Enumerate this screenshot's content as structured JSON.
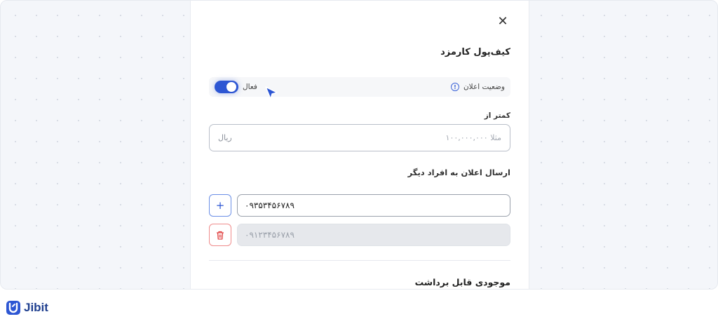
{
  "panel": {
    "title": "کیف‌پول کارمزد",
    "close_icon": "close-icon",
    "status": {
      "label": "وضعیت اعلان",
      "info_icon": "info-icon",
      "toggle_label": "فعال",
      "toggle_on": true
    },
    "threshold": {
      "label": "کمتر از",
      "placeholder": "مثلا ۱۰۰,۰۰۰,۰۰۰",
      "unit": "ریال"
    },
    "notify_others": {
      "label": "ارسال اعلان به افراد دیگر",
      "phones": [
        {
          "value": "۰۹۳۵۳۴۵۶۷۸۹",
          "state": "active",
          "action_icon": "plus-icon"
        },
        {
          "value": "۰۹۱۲۳۴۵۶۷۸۹",
          "state": "disabled",
          "action_icon": "trash-icon"
        }
      ]
    },
    "balance_label": "موجودی قابل برداشت"
  },
  "brand": {
    "name": "Jibit"
  },
  "colors": {
    "accent": "#2d56d3",
    "danger": "#e14545",
    "brand": "#1f3f8f"
  }
}
